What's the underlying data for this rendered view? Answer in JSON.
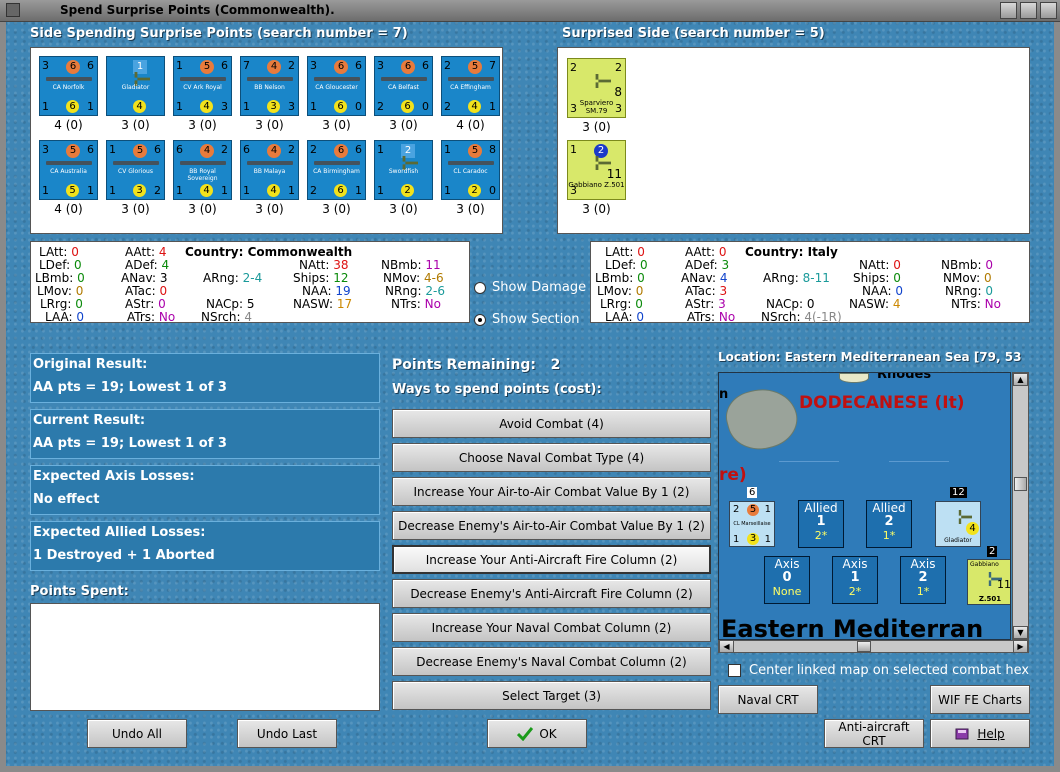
{
  "window": {
    "title": "Spend Surprise Points (Commonwealth)."
  },
  "left_panel": {
    "header": "Side Spending Surprise Points (search number = 7)"
  },
  "right_panel": {
    "header": "Surprised Side (search number = 5)"
  },
  "left_units": [
    {
      "name": "CA Norfolk",
      "a": "3",
      "b": "6",
      "c": "6",
      "d": "1",
      "e": "6",
      "f": "1",
      "cap": "4 (0)",
      "kind": "ship"
    },
    {
      "name": "Gladiator",
      "a": "",
      "b": "1",
      "c": "",
      "d": "",
      "e": "4",
      "f": "",
      "cap": "3 (0)",
      "kind": "plane"
    },
    {
      "name": "CV Ark Royal",
      "a": "1",
      "b": "5",
      "c": "6",
      "d": "1",
      "e": "4",
      "f": "3",
      "cap": "3 (0)",
      "kind": "ship"
    },
    {
      "name": "BB Nelson",
      "a": "7",
      "b": "4",
      "c": "2",
      "d": "1",
      "e": "3",
      "f": "3",
      "cap": "3 (0)",
      "kind": "ship"
    },
    {
      "name": "CA Gloucester",
      "a": "3",
      "b": "6",
      "c": "6",
      "d": "1",
      "e": "6",
      "f": "0",
      "cap": "3 (0)",
      "kind": "ship"
    },
    {
      "name": "CA Belfast",
      "a": "3",
      "b": "6",
      "c": "6",
      "d": "2",
      "e": "6",
      "f": "0",
      "cap": "3 (0)",
      "kind": "ship"
    },
    {
      "name": "CA Effingham",
      "a": "2",
      "b": "5",
      "c": "7",
      "d": "2",
      "e": "4",
      "f": "1",
      "cap": "4 (0)",
      "kind": "ship"
    },
    {
      "name": "CA Australia",
      "a": "3",
      "b": "5",
      "c": "6",
      "d": "1",
      "e": "5",
      "f": "1",
      "cap": "4 (0)",
      "kind": "ship"
    },
    {
      "name": "CV Glorious",
      "a": "1",
      "b": "5",
      "c": "6",
      "d": "1",
      "e": "3",
      "f": "2",
      "cap": "3 (0)",
      "kind": "ship"
    },
    {
      "name": "BB Royal Sovereign",
      "a": "6",
      "b": "4",
      "c": "2",
      "d": "1",
      "e": "4",
      "f": "1",
      "cap": "3 (0)",
      "kind": "ship"
    },
    {
      "name": "BB Malaya",
      "a": "6",
      "b": "4",
      "c": "2",
      "d": "1",
      "e": "4",
      "f": "1",
      "cap": "3 (0)",
      "kind": "ship"
    },
    {
      "name": "CA Birmingham",
      "a": "2",
      "b": "6",
      "c": "6",
      "d": "2",
      "e": "6",
      "f": "1",
      "cap": "3 (0)",
      "kind": "ship"
    },
    {
      "name": "Swordfish",
      "a": "1",
      "b": "2",
      "c": "",
      "d": "1",
      "e": "2",
      "f": "",
      "cap": "3 (0)",
      "kind": "plane"
    },
    {
      "name": "CL Caradoc",
      "a": "1",
      "b": "5",
      "c": "8",
      "d": "1",
      "e": "2",
      "f": "0",
      "cap": "3 (0)",
      "kind": "ship"
    }
  ],
  "right_units": [
    {
      "name": "Sparviero SM.79",
      "a": "2",
      "b": "",
      "c": "2",
      "d": "3",
      "e": "8",
      "f": "3",
      "cap": "3 (0)"
    },
    {
      "name": "Gabbiano Z.501",
      "a": "1",
      "b": "2",
      "c": "",
      "d": "3",
      "e": "11",
      "f": "",
      "cap": "3 (0)"
    }
  ],
  "left_stats": {
    "country_label": "Country:",
    "country": "Commonwealth",
    "latt": "0",
    "ldef": "0",
    "lbmb": "0",
    "lmov": "0",
    "lrrg": "0",
    "laa": "0",
    "aatt": "4",
    "adef": "4",
    "anav": "3",
    "atac": "0",
    "astr": "0",
    "atrs": "No",
    "arng": "2-4",
    "nacp": "5",
    "nsrch": "4",
    "natt": "38",
    "ships": "12",
    "naa": "19",
    "nasw": "17",
    "nbmb": "11",
    "nmov": "4-6",
    "nrng": "2-6",
    "ntrs": "No"
  },
  "right_stats": {
    "country_label": "Country:",
    "country": "Italy",
    "latt": "0",
    "ldef": "0",
    "lbmb": "0",
    "lmov": "0",
    "lrrg": "0",
    "laa": "0",
    "aatt": "0",
    "adef": "3",
    "anav": "4",
    "atac": "3",
    "astr": "3",
    "atrs": "No",
    "arng": "8-11",
    "nacp": "0",
    "nsrch": "4(-1R)",
    "natt": "0",
    "ships": "0",
    "naa": "0",
    "nasw": "4",
    "nbmb": "0",
    "nmov": "0",
    "nrng": "0",
    "ntrs": "No"
  },
  "options": {
    "show_damage": "Show Damage",
    "show_section": "Show Section"
  },
  "results": [
    {
      "title": "Original Result:",
      "value": "AA pts = 19; Lowest 1 of 3"
    },
    {
      "title": "Current Result:",
      "value": "AA pts = 19; Lowest 1 of 3"
    },
    {
      "title": "Expected Axis Losses:",
      "value": "No effect"
    },
    {
      "title": "Expected Allied Losses:",
      "value": "1 Destroyed + 1 Aborted"
    }
  ],
  "points_spent_label": "Points Spent:",
  "points_remaining_label": "Points Remaining:",
  "points_remaining": "2",
  "ways_label": "Ways to spend points (cost):",
  "actions": [
    "Avoid Combat (4)",
    "Choose Naval Combat Type (4)",
    "Increase Your Air-to-Air Combat Value By 1 (2)",
    "Decrease Enemy's Air-to-Air Combat Value By 1 (2)",
    "Increase Your Anti-Aircraft Fire Column (2)",
    "Decrease Enemy's Anti-Aircraft Fire Column (2)",
    "Increase Your Naval Combat Column (2)",
    "Decrease Enemy's Naval Combat Column (2)",
    "Select Target (3)"
  ],
  "location": "Location: Eastern Mediterranean Sea [79, 53",
  "map": {
    "rhodes": "Rhodes",
    "n": "n",
    "dodecanese": "DODECANESE (It)",
    "re": "re)",
    "sea": "Eastern Mediterran",
    "allied_boxes": [
      {
        "t": "Allied",
        "n": "1",
        "s": "2*"
      },
      {
        "t": "Allied",
        "n": "2",
        "s": "1*"
      }
    ],
    "axis_boxes": [
      {
        "t": "Axis",
        "n": "0",
        "s": "None"
      },
      {
        "t": "Axis",
        "n": "1",
        "s": "2*"
      },
      {
        "t": "Axis",
        "n": "2",
        "s": "1*"
      }
    ],
    "stack1_count": "6",
    "stack2_count": "12",
    "stack3_count": "2",
    "marseillaise": "CL Marseillaise",
    "marseillaise_vals": [
      "2",
      "5",
      "1",
      "1",
      "3",
      "1"
    ],
    "gladiator": "Gladiator",
    "gladiator_val": "4",
    "gabbiano": "Gabbiano",
    "z501": "Z.501",
    "gabbiano_val": "11"
  },
  "center_linked_label": "Center linked map on selected combat hex",
  "buttons": {
    "undo_all": "Undo All",
    "undo_last": "Undo Last",
    "ok": "OK",
    "naval_crt": "Naval CRT",
    "wif_charts": "WIF FE Charts",
    "aa_crt": "Anti-aircraft CRT",
    "help": "Help"
  }
}
